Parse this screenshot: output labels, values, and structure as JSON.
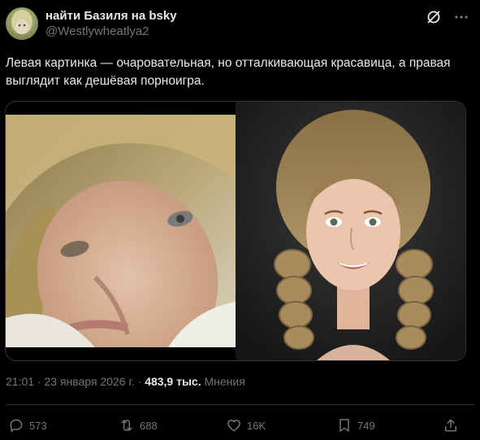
{
  "author": {
    "display_name": "найти Базиля на bsky",
    "handle": "@Westlywheatlya2"
  },
  "tweet": {
    "text": "Левая картинка — очаровательная, но отталкивающая красавица, а правая выглядит как дешёвая порноигра."
  },
  "meta": {
    "time_date": "21:01 · 23 января 2026 г. · ",
    "views_count": "483,9 тыс.",
    "views_label": "Мнения"
  },
  "actions": {
    "replies": "573",
    "reposts": "688",
    "likes": "16K",
    "bookmarks": "749"
  },
  "icons": [
    "avatar",
    "grok-icon",
    "reply-icon",
    "repost-icon",
    "like-icon",
    "bookmark-icon",
    "share-icon"
  ],
  "colors": {
    "background": "#000000",
    "text": "#e7e9ea",
    "secondary": "#71767b",
    "border": "#2f3336"
  }
}
